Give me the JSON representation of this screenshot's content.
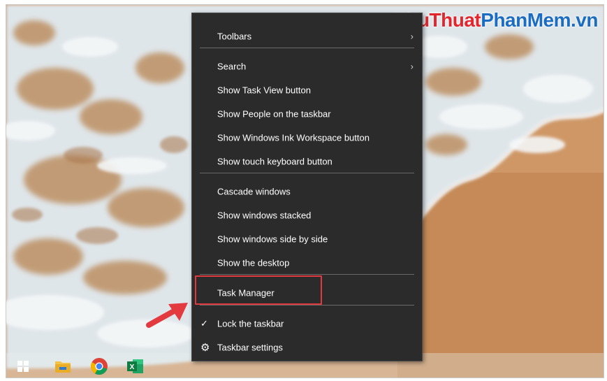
{
  "watermark": {
    "part1": "Thu",
    "part2": "Thuat",
    "part3": "Phan",
    "part4": "Mem",
    "part5": ".vn"
  },
  "context_menu": {
    "items": [
      {
        "label": "Toolbars",
        "has_submenu": true
      },
      {
        "label": "Search",
        "has_submenu": true
      },
      {
        "label": "Show Task View button"
      },
      {
        "label": "Show People on the taskbar"
      },
      {
        "label": "Show Windows Ink Workspace button"
      },
      {
        "label": "Show touch keyboard button"
      },
      {
        "label": "Cascade windows"
      },
      {
        "label": "Show windows stacked"
      },
      {
        "label": "Show windows side by side"
      },
      {
        "label": "Show the desktop"
      },
      {
        "label": "Task Manager",
        "highlighted": true
      },
      {
        "label": "Lock the taskbar",
        "checked": true
      },
      {
        "label": "Taskbar settings",
        "icon": "gear-icon"
      }
    ],
    "submenu_glyph": "›",
    "check_glyph": "✓",
    "gear_glyph": "⚙"
  },
  "taskbar": {
    "icons": [
      "windows-start-icon",
      "file-explorer-icon",
      "chrome-icon",
      "excel-icon"
    ],
    "excel_letter": "X"
  },
  "colors": {
    "menu_bg": "#2b2b2b",
    "menu_text": "#ffffff",
    "highlight_box": "#e0393e",
    "arrow": "#e23a3f",
    "sand": "#c98e5d",
    "foam": "#e6ecef"
  }
}
